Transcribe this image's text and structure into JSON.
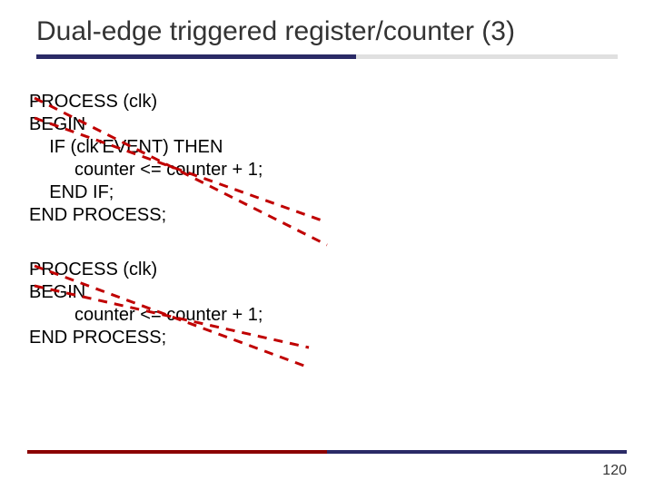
{
  "title": "Dual-edge triggered register/counter (3)",
  "code1": {
    "l1": "PROCESS (clk)",
    "l2": "BEGIN",
    "l3": "    IF (clk'EVENT) THEN",
    "l4": "         counter <= counter + 1;",
    "l5": "    END IF;",
    "l6": "END PROCESS;"
  },
  "code2": {
    "l1": "PROCESS (clk)",
    "l2": "BEGIN",
    "l3": "         counter <= counter + 1;",
    "l4": "END PROCESS;"
  },
  "page": "120",
  "strikeColor": "#c00000"
}
